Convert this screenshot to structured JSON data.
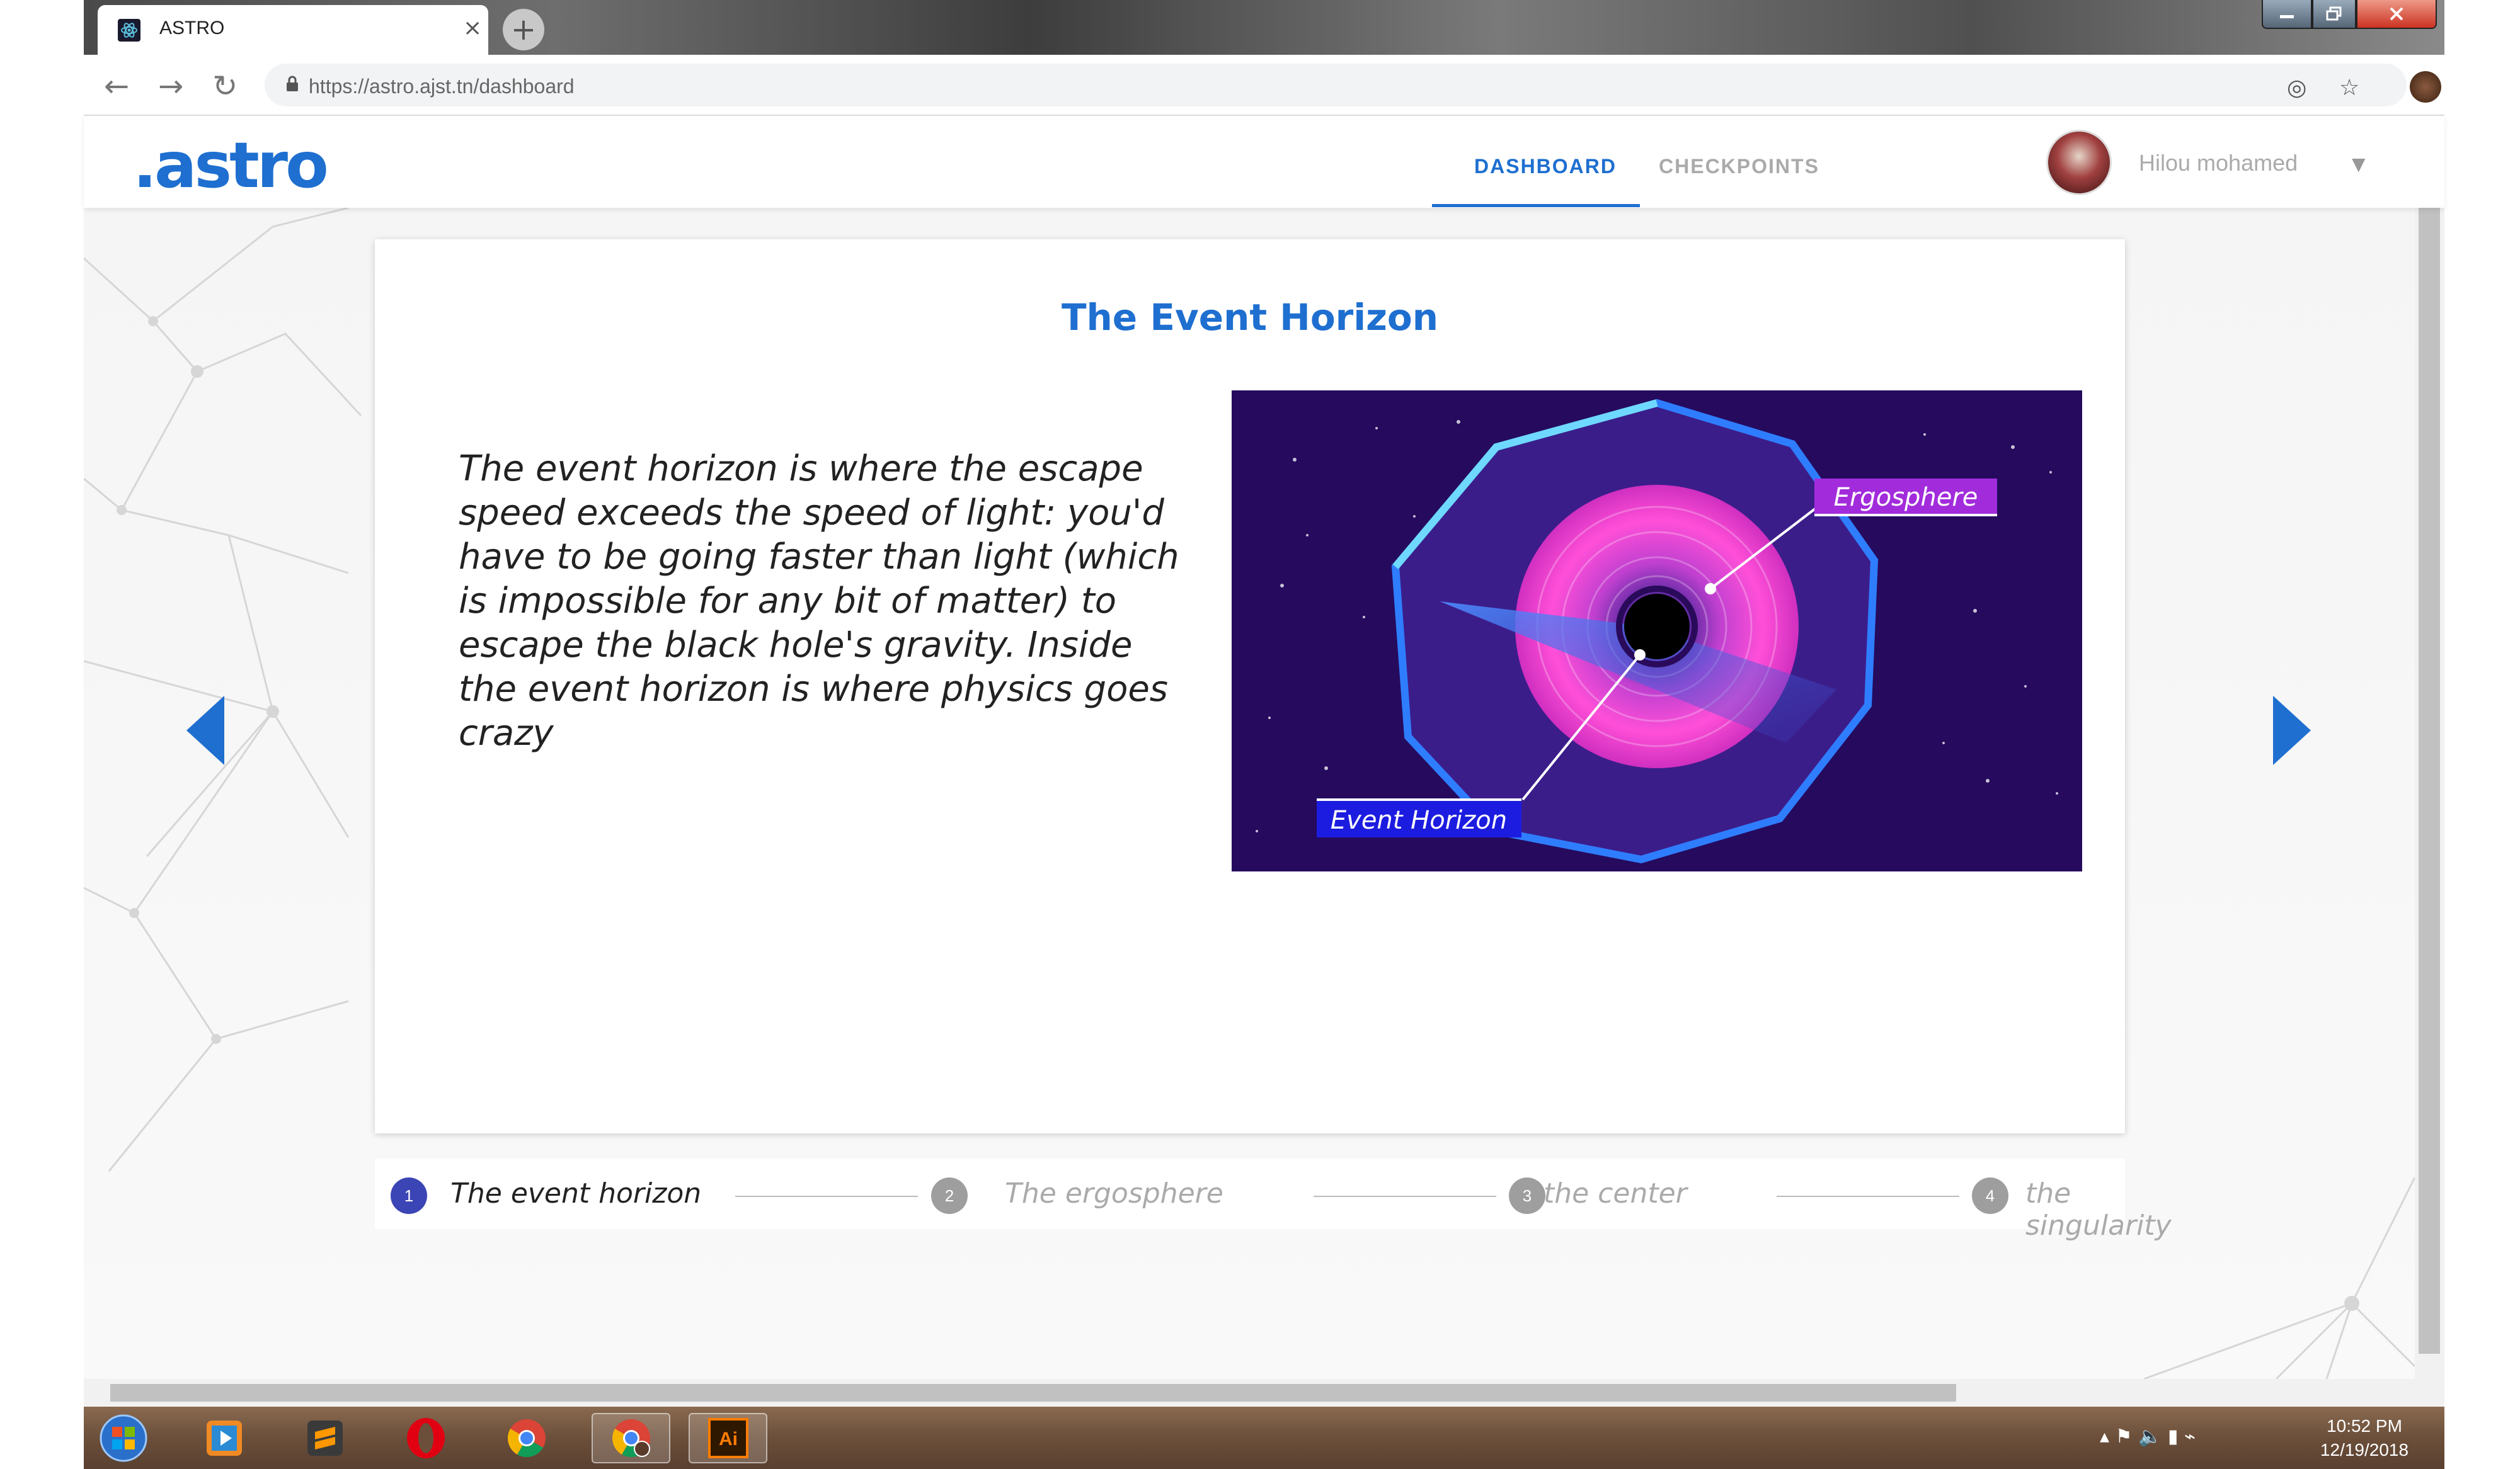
{
  "browser": {
    "tab_title": "ASTRO",
    "tab_close": "×",
    "new_tab": "+",
    "url_host": "https://astro.ajst.tn",
    "url_path": "/dashboard",
    "icons": [
      "back-icon",
      "forward-icon",
      "reload-icon",
      "lock-icon",
      "location-icon",
      "star-icon",
      "profile-icon",
      "menu-icon"
    ]
  },
  "app": {
    "logo": ".astro",
    "nav": {
      "dashboard": "DASHBOARD",
      "checkpoints": "CHECKPOINTS"
    },
    "user": {
      "name": "Hilou mohamed"
    },
    "accent_color": "#1e6fd0"
  },
  "slide": {
    "title": "The Event Horizon",
    "text": "The event horizon is where the escape speed exceeds the speed of light: you'd have to be going faster than light (which is impossible for any bit of matter) to escape the black hole's gravity. Inside the event horizon is where physics goes crazy",
    "image_labels": {
      "ergosphere": "Ergosphere",
      "event_horizon": "Event Horizon"
    }
  },
  "stepper": {
    "steps": [
      {
        "number": "1",
        "label": "The event horizon",
        "active": true
      },
      {
        "number": "2",
        "label": "The ergosphere",
        "active": false
      },
      {
        "number": "3",
        "label": "the center",
        "active": false
      },
      {
        "number": "4",
        "label": "the singularity",
        "active": false
      }
    ]
  },
  "taskbar": {
    "time": "10:52 PM",
    "date": "12/19/2018",
    "apps": [
      "start-icon",
      "media-player-icon",
      "sublime-text-icon",
      "opera-icon",
      "chrome-icon",
      "chrome-profile-icon",
      "illustrator-icon"
    ]
  }
}
